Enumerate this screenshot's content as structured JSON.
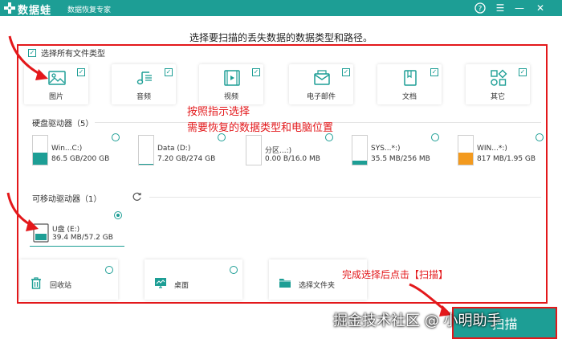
{
  "app": {
    "name": "数据蛙",
    "subtitle": "数据恢复专家"
  },
  "titlebar_buttons": {
    "help": "?",
    "menu": "☰",
    "minimize": "—",
    "close": "✕"
  },
  "headline": "选择要扫描的丢失数据的数据类型和路径。",
  "select_all": {
    "label": "选择所有文件类型",
    "checked": true
  },
  "categories": [
    {
      "label": "图片",
      "icon": "image-icon",
      "checked": true
    },
    {
      "label": "音频",
      "icon": "music-icon",
      "checked": true
    },
    {
      "label": "视频",
      "icon": "video-icon",
      "checked": true
    },
    {
      "label": "电子邮件",
      "icon": "email-icon",
      "checked": true
    },
    {
      "label": "文档",
      "icon": "document-icon",
      "checked": true
    },
    {
      "label": "其它",
      "icon": "other-icon",
      "checked": true
    }
  ],
  "hard_drives": {
    "label": "硬盘驱动器（5）",
    "items": [
      {
        "name": "Win...C:)",
        "size": "86.5 GB/200 GB",
        "usage": 0.43,
        "color": "#1d9e95"
      },
      {
        "name": "Data (D:)",
        "size": "7.20 GB/274 GB",
        "usage": 0.03,
        "color": "#1d9e95"
      },
      {
        "name": "分区...:)",
        "size": "0.00  B/16.0 MB",
        "usage": 0.0,
        "color": "#1d9e95"
      },
      {
        "name": "SYS...*:)",
        "size": "35.5 MB/256 MB",
        "usage": 0.14,
        "color": "#1d9e95"
      },
      {
        "name": "WIN...*:)",
        "size": "817 MB/1.95 GB",
        "usage": 0.42,
        "color": "#f39a1e"
      }
    ]
  },
  "removable": {
    "label": "可移动驱动器（1）",
    "items": [
      {
        "name": "U盘 (E:)",
        "size": "39.4 MB/57.2 GB",
        "selected": true
      }
    ]
  },
  "locations": [
    {
      "label": "回收站",
      "icon": "recycle-bin-icon"
    },
    {
      "label": "桌面",
      "icon": "desktop-icon"
    },
    {
      "label": "选择文件夹",
      "icon": "folder-icon"
    }
  ],
  "annotations": {
    "line1": "按照指示选择",
    "line2": "需要恢复的数据类型和电脑位置",
    "done": "完成选择后点击【扫描】"
  },
  "scan_button": "扫描",
  "watermark": "掘金技术社区 @ 小明助手",
  "colors": {
    "accent": "#1d9e95",
    "annotation": "#e3181b",
    "warning": "#f39a1e"
  }
}
